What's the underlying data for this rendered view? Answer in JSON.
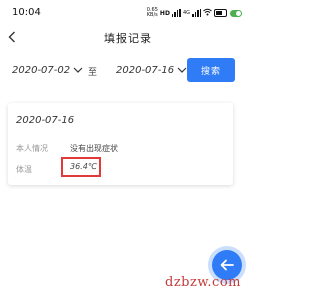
{
  "status_bar": {
    "time": "10:04",
    "speed": "0.65",
    "speed_unit": "KB/s",
    "hd": "HD",
    "net": "4G"
  },
  "nav": {
    "title": "填报记录"
  },
  "filter": {
    "start_date": "2020-07-02",
    "separator": "至",
    "end_date": "2020-07-16",
    "search_label": "搜索"
  },
  "record": {
    "date": "2020-07-16",
    "status_label": "本人情况",
    "status_value": "没有出现症状",
    "temp_label": "体温",
    "temp_value": "36.4℃"
  },
  "watermark": "dzbzw.com",
  "colors": {
    "accent": "#2f7cf6",
    "highlight": "#e23a3a"
  }
}
